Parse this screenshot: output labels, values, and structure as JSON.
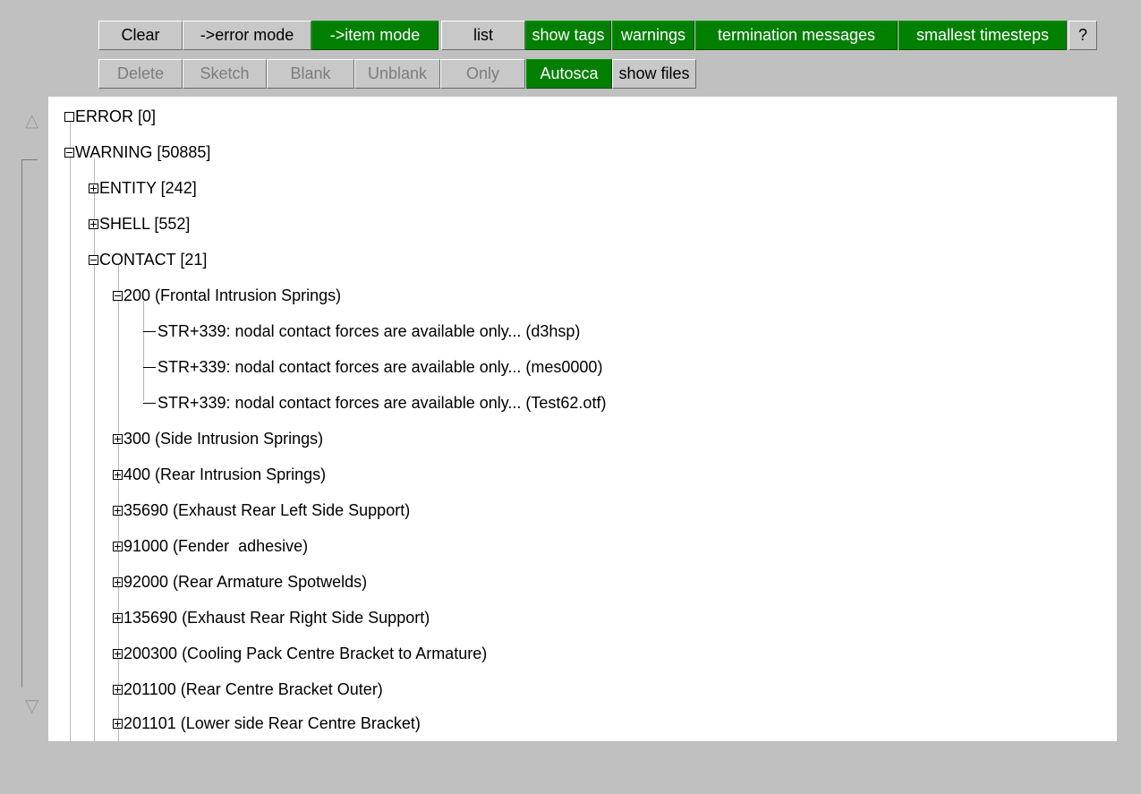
{
  "toolbar": {
    "row1": [
      {
        "label": "Clear",
        "active": false
      },
      {
        "label": "->error mode",
        "active": false
      },
      {
        "label": "->item mode",
        "active": true
      },
      {
        "label": "list",
        "active": false
      },
      {
        "label": "show tags",
        "active": true
      },
      {
        "label": "warnings",
        "active": true
      },
      {
        "label": "termination messages",
        "active": true
      },
      {
        "label": "smallest timesteps",
        "active": true
      },
      {
        "label": "?",
        "active": false
      }
    ],
    "row2": [
      {
        "label": "Delete",
        "disabled": true
      },
      {
        "label": "Sketch",
        "disabled": true
      },
      {
        "label": "Blank",
        "disabled": true
      },
      {
        "label": "Unblank",
        "disabled": true
      },
      {
        "label": "Only",
        "disabled": true
      },
      {
        "label": "Autosca",
        "active": true
      },
      {
        "label": "show files",
        "active": false
      }
    ]
  },
  "tree": {
    "rows": [
      {
        "text": "ERROR [0]",
        "type": "empty"
      },
      {
        "text": "WARNING [50885]",
        "type": "expanded"
      },
      {
        "text": "ENTITY [242]",
        "type": "collapsed"
      },
      {
        "text": "SHELL [552]",
        "type": "collapsed"
      },
      {
        "text": "CONTACT [21]",
        "type": "expanded"
      },
      {
        "text": "200 (Frontal Intrusion Springs)",
        "type": "expanded"
      },
      {
        "text": "STR+339: nodal contact forces are available only... (d3hsp)",
        "type": "leaf"
      },
      {
        "text": "STR+339: nodal contact forces are available only... (mes0000)",
        "type": "leaf"
      },
      {
        "text": "STR+339: nodal contact forces are available only... (Test62.otf)",
        "type": "leaf"
      },
      {
        "text": "300 (Side Intrusion Springs)",
        "type": "collapsed"
      },
      {
        "text": "400 (Rear Intrusion Springs)",
        "type": "collapsed"
      },
      {
        "text": "35690 (Exhaust Rear Left Side Support)",
        "type": "collapsed"
      },
      {
        "text": "91000 (Fender  adhesive)",
        "type": "collapsed"
      },
      {
        "text": "92000 (Rear Armature Spotwelds)",
        "type": "collapsed"
      },
      {
        "text": "135690 (Exhaust Rear Right Side Support)",
        "type": "collapsed"
      },
      {
        "text": "200300 (Cooling Pack Centre Bracket to Armature)",
        "type": "collapsed"
      },
      {
        "text": "201100 (Rear Centre Bracket Outer)",
        "type": "collapsed"
      },
      {
        "text": "201101 (Lower side Rear Centre Bracket)",
        "type": "collapsed"
      }
    ]
  },
  "scrollbar": {
    "up_icon": "triangle-up",
    "down_icon": "triangle-down"
  },
  "colors": {
    "active_green": "#007f00",
    "panel_bg": "#c0c0c0",
    "tree_bg": "#ffffff"
  }
}
